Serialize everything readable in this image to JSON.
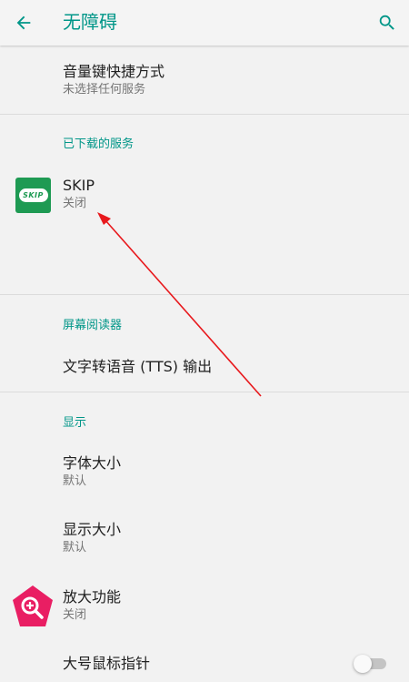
{
  "header": {
    "title": "无障碍",
    "back_icon": "arrow-back-icon",
    "search_icon": "search-icon"
  },
  "volume_shortcut": {
    "title": "音量键快捷方式",
    "summary": "未选择任何服务"
  },
  "downloaded_services": {
    "header": "已下载的服务"
  },
  "skip_service": {
    "title": "SKIP",
    "summary": "关闭",
    "icon_text": "SKIP"
  },
  "screen_reader": {
    "header": "屏幕阅读器"
  },
  "tts": {
    "title": "文字转语音 (TTS) 输出"
  },
  "display": {
    "header": "显示"
  },
  "font_size": {
    "title": "字体大小",
    "summary": "默认"
  },
  "display_size": {
    "title": "显示大小",
    "summary": "默认"
  },
  "magnification": {
    "title": "放大功能",
    "summary": "关闭"
  },
  "large_pointer": {
    "title": "大号鼠标指针",
    "toggle_state": "off"
  },
  "colors": {
    "accent": "#009688",
    "skip_green": "#1e9a53",
    "magnify_pink": "#e91e63",
    "annotation_arrow": "#e8191d"
  }
}
